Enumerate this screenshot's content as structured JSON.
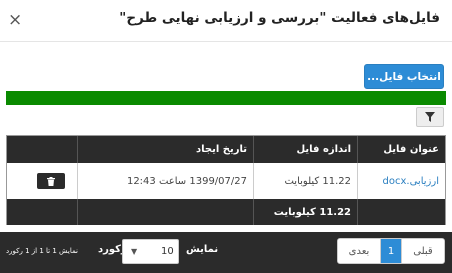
{
  "dialog": {
    "title": "فایل‌های فعالیت \"بررسی و ارزیابی نهایی طرح\"",
    "close_glyph": "×"
  },
  "toolbar": {
    "choose_file_label": "انتخاب فایل...",
    "upload_progress": 1.0,
    "filter_icon": "filter-icon"
  },
  "table": {
    "columns": [
      "عنوان فایل",
      "اندازه فایل",
      "تاریخ ایجاد"
    ],
    "rows": [
      {
        "title": "ارزیابی.docx",
        "size": "11.22 کیلوبایت",
        "created": "1399/07/27 ساعت 12:43",
        "delete_icon": "trash-icon"
      }
    ],
    "footer_total": "11.22 کیلوبایت"
  },
  "pagination": {
    "info": "نمایش 1 تا 1 از 1 رکورد",
    "records_label": "رکورد",
    "page_size": "10",
    "show_label": "نمایش",
    "prev_label": "قبلی",
    "current_page": "1",
    "next_label": "بعدی"
  },
  "colors": {
    "primary": "#2d8cd6",
    "progress": "#0a8a00",
    "dark": "#2b2b2b"
  }
}
